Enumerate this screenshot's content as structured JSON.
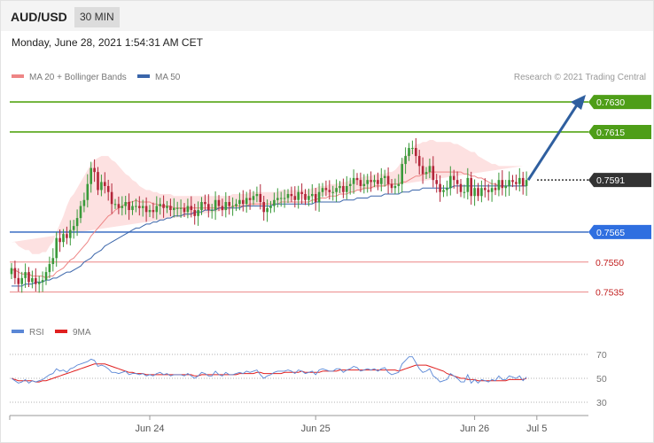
{
  "header": {
    "pair": "AUD/USD",
    "timeframe": "30 MIN"
  },
  "datetime": "Monday, June 28, 2021 1:54:31 AM CET",
  "legend": {
    "ma20_label": "MA 20 + Bollinger Bands",
    "ma50_label": "MA 50"
  },
  "copyright": "Research © 2021 Trading Central",
  "colors": {
    "up": "#3a9a3a",
    "down": "#b3263a",
    "ma20": "#ee8585",
    "ma50": "#3a65aa",
    "band_fill": "#fddcdc",
    "resistance": "#55a515",
    "support": "#4a78c8",
    "target": "#e55555",
    "current": "#333333",
    "arrow": "#2f5f9f",
    "rsi": "#5a87d6",
    "rsi_ma": "#e02020"
  },
  "levels": [
    {
      "price": 0.763,
      "label": "0.7630",
      "kind": "resistance"
    },
    {
      "price": 0.7615,
      "label": "0.7615",
      "kind": "resistance"
    },
    {
      "price": 0.7591,
      "label": "0.7591",
      "kind": "current"
    },
    {
      "price": 0.7565,
      "label": "0.7565",
      "kind": "support"
    },
    {
      "price": 0.755,
      "label": "0.7550",
      "kind": "target"
    },
    {
      "price": 0.7535,
      "label": "0.7535",
      "kind": "target"
    }
  ],
  "x_axis": {
    "ticks": [
      {
        "label": "Jun 24",
        "index": 40
      },
      {
        "label": "Jun 25",
        "index": 88
      },
      {
        "label": "Jun 26",
        "index": 134
      },
      {
        "label": "Jul 5",
        "index": 152
      }
    ]
  },
  "rsi_panel": {
    "label": "RSI",
    "ma_label": "9MA",
    "ticks": [
      70,
      50,
      30
    ],
    "tick_labels": [
      "70",
      "50",
      "30"
    ]
  },
  "chart_data": {
    "type": "candlestick",
    "symbol": "AUD/USD",
    "interval": "30 MIN",
    "ylim": [
      0.7526,
      0.7638
    ],
    "candle_count": 150,
    "closes": [
      0.7547,
      0.7542,
      0.7539,
      0.7542,
      0.7545,
      0.754,
      0.7542,
      0.7539,
      0.754,
      0.7541,
      0.7545,
      0.7549,
      0.7552,
      0.7562,
      0.756,
      0.7564,
      0.7562,
      0.7566,
      0.7568,
      0.7572,
      0.7578,
      0.7581,
      0.7589,
      0.7597,
      0.7595,
      0.7586,
      0.759,
      0.7588,
      0.7585,
      0.7579,
      0.7579,
      0.7577,
      0.7578,
      0.758,
      0.7576,
      0.7578,
      0.7578,
      0.7577,
      0.7578,
      0.7575,
      0.7576,
      0.7575,
      0.7578,
      0.7579,
      0.7577,
      0.7578,
      0.7576,
      0.7577,
      0.7577,
      0.7577,
      0.7575,
      0.7578,
      0.7576,
      0.7573,
      0.7576,
      0.758,
      0.7579,
      0.7576,
      0.7576,
      0.7581,
      0.7578,
      0.7576,
      0.758,
      0.7578,
      0.7578,
      0.7579,
      0.7581,
      0.7579,
      0.7582,
      0.7581,
      0.7583,
      0.7584,
      0.758,
      0.7575,
      0.7577,
      0.7578,
      0.7581,
      0.7582,
      0.7582,
      0.7582,
      0.7584,
      0.7583,
      0.7581,
      0.7585,
      0.7584,
      0.7581,
      0.7583,
      0.7584,
      0.758,
      0.7585,
      0.7587,
      0.7586,
      0.7585,
      0.7585,
      0.7587,
      0.7588,
      0.7585,
      0.7588,
      0.7589,
      0.7592,
      0.7591,
      0.7588,
      0.7589,
      0.7591,
      0.759,
      0.7591,
      0.7589,
      0.7592,
      0.7593,
      0.7589,
      0.7587,
      0.7588,
      0.7589,
      0.7599,
      0.7603,
      0.7607,
      0.7607,
      0.7603,
      0.7598,
      0.7594,
      0.7595,
      0.7598,
      0.7591,
      0.7589,
      0.7585,
      0.7586,
      0.7587,
      0.7593,
      0.7591,
      0.7589,
      0.7585,
      0.7585,
      0.7592,
      0.7583,
      0.7587,
      0.7583,
      0.7587,
      0.7586,
      0.7585,
      0.7587,
      0.7586,
      0.7591,
      0.7587,
      0.7588,
      0.7591,
      0.759,
      0.7589,
      0.7592,
      0.7588,
      0.7591
    ],
    "ma20": [
      0.7546,
      0.7546,
      0.7545,
      0.7544,
      0.7544,
      0.7544,
      0.7543,
      0.7543,
      0.7543,
      0.7543,
      0.7542,
      0.7543,
      0.7543,
      0.7545,
      0.7546,
      0.7547,
      0.7549,
      0.7551,
      0.7552,
      0.7554,
      0.7556,
      0.7558,
      0.756,
      0.7563,
      0.7565,
      0.7567,
      0.7569,
      0.7571,
      0.7573,
      0.7574,
      0.7576,
      0.7577,
      0.7578,
      0.7579,
      0.758,
      0.758,
      0.7581,
      0.758,
      0.758,
      0.758,
      0.758,
      0.7579,
      0.7579,
      0.7578,
      0.7578,
      0.7578,
      0.7578,
      0.7577,
      0.7577,
      0.7577,
      0.7577,
      0.7577,
      0.7577,
      0.7577,
      0.7577,
      0.7577,
      0.7577,
      0.7577,
      0.7577,
      0.7577,
      0.7577,
      0.7577,
      0.7577,
      0.7577,
      0.7578,
      0.7578,
      0.7578,
      0.7578,
      0.7578,
      0.7579,
      0.7579,
      0.7579,
      0.7579,
      0.7579,
      0.7579,
      0.7579,
      0.7579,
      0.7579,
      0.758,
      0.758,
      0.758,
      0.758,
      0.758,
      0.758,
      0.758,
      0.758,
      0.758,
      0.7581,
      0.7581,
      0.7582,
      0.7582,
      0.7582,
      0.7583,
      0.7583,
      0.7583,
      0.7584,
      0.7584,
      0.7584,
      0.7585,
      0.7585,
      0.7586,
      0.7586,
      0.7587,
      0.7587,
      0.7587,
      0.7588,
      0.7588,
      0.7588,
      0.7588,
      0.7589,
      0.7589,
      0.7589,
      0.7589,
      0.759,
      0.759,
      0.7591,
      0.7592,
      0.7593,
      0.7593,
      0.7594,
      0.7594,
      0.7595,
      0.7595,
      0.7595,
      0.7595,
      0.7595,
      0.7595,
      0.7595,
      0.7595,
      0.7595,
      0.7595,
      0.7594,
      0.7594,
      0.7593,
      0.7593,
      0.7592,
      0.7592,
      0.7591,
      0.759,
      0.7589,
      0.7589,
      0.7588,
      0.7588,
      0.7588,
      0.7588,
      0.7588,
      0.7588,
      0.7588,
      0.7588,
      0.7588
    ],
    "ma50": [
      0.7538,
      0.7538,
      0.7538,
      0.7538,
      0.7539,
      0.7539,
      0.7539,
      0.754,
      0.754,
      0.754,
      0.7541,
      0.7541,
      0.7542,
      0.7542,
      0.7543,
      0.7544,
      0.7545,
      0.7545,
      0.7546,
      0.7547,
      0.7548,
      0.755,
      0.7551,
      0.7552,
      0.7554,
      0.7555,
      0.7556,
      0.7558,
      0.7559,
      0.756,
      0.7561,
      0.7562,
      0.7563,
      0.7564,
      0.7565,
      0.7566,
      0.7567,
      0.7567,
      0.7568,
      0.7569,
      0.7569,
      0.757,
      0.757,
      0.7571,
      0.7571,
      0.7572,
      0.7572,
      0.7573,
      0.7573,
      0.7573,
      0.7574,
      0.7574,
      0.7574,
      0.7575,
      0.7575,
      0.7575,
      0.7576,
      0.7576,
      0.7576,
      0.7576,
      0.7577,
      0.7577,
      0.7577,
      0.7577,
      0.7577,
      0.7577,
      0.7577,
      0.7578,
      0.7578,
      0.7578,
      0.7578,
      0.7578,
      0.7578,
      0.7578,
      0.7578,
      0.7578,
      0.7579,
      0.7579,
      0.7579,
      0.7579,
      0.7579,
      0.7579,
      0.7579,
      0.7579,
      0.7579,
      0.7579,
      0.7579,
      0.7579,
      0.758,
      0.758,
      0.758,
      0.758,
      0.758,
      0.758,
      0.758,
      0.758,
      0.7581,
      0.7581,
      0.7581,
      0.7581,
      0.7582,
      0.7582,
      0.7582,
      0.7582,
      0.7583,
      0.7583,
      0.7583,
      0.7583,
      0.7584,
      0.7584,
      0.7584,
      0.7584,
      0.7584,
      0.7585,
      0.7585,
      0.7585,
      0.7586,
      0.7586,
      0.7586,
      0.7587,
      0.7587,
      0.7587,
      0.7587,
      0.7587,
      0.7587,
      0.7587,
      0.7587,
      0.7587,
      0.7588,
      0.7588,
      0.7588,
      0.7588,
      0.7588,
      0.7588,
      0.7588,
      0.7588,
      0.7588,
      0.7588,
      0.7588,
      0.7588,
      0.7588,
      0.7588,
      0.7588,
      0.7588,
      0.7588,
      0.7588,
      0.7588,
      0.7588,
      0.7588,
      0.7588
    ],
    "band_halfwidth": [
      0.0014,
      0.0014,
      0.0013,
      0.0013,
      0.0012,
      0.0012,
      0.0011,
      0.0011,
      0.0011,
      0.0012,
      0.0013,
      0.0015,
      0.0017,
      0.002,
      0.0023,
      0.0026,
      0.0029,
      0.0031,
      0.0032,
      0.0033,
      0.0034,
      0.0035,
      0.0036,
      0.0036,
      0.0036,
      0.0035,
      0.0034,
      0.0032,
      0.003,
      0.0027,
      0.0024,
      0.0021,
      0.0018,
      0.0015,
      0.0013,
      0.0011,
      0.0009,
      0.0008,
      0.0007,
      0.0006,
      0.0006,
      0.0006,
      0.0006,
      0.0006,
      0.0006,
      0.0006,
      0.0006,
      0.0006,
      0.0006,
      0.0006,
      0.0006,
      0.0006,
      0.0006,
      0.0006,
      0.0006,
      0.0006,
      0.0006,
      0.0006,
      0.0006,
      0.0006,
      0.0006,
      0.0006,
      0.0006,
      0.0006,
      0.0006,
      0.0006,
      0.0006,
      0.0006,
      0.0006,
      0.0006,
      0.0006,
      0.0006,
      0.0006,
      0.0006,
      0.0006,
      0.0006,
      0.0006,
      0.0006,
      0.0006,
      0.0006,
      0.0006,
      0.0006,
      0.0006,
      0.0006,
      0.0006,
      0.0006,
      0.0006,
      0.0006,
      0.0006,
      0.0006,
      0.0006,
      0.0006,
      0.0006,
      0.0006,
      0.0006,
      0.0006,
      0.0006,
      0.0006,
      0.0006,
      0.0006,
      0.0006,
      0.0006,
      0.0006,
      0.0006,
      0.0006,
      0.0006,
      0.0006,
      0.0006,
      0.0006,
      0.0006,
      0.0006,
      0.0007,
      0.0009,
      0.0011,
      0.0013,
      0.0014,
      0.0015,
      0.0016,
      0.0016,
      0.0016,
      0.0016,
      0.0016,
      0.0016,
      0.0015,
      0.0015,
      0.0015,
      0.0015,
      0.0015,
      0.0014,
      0.0014,
      0.0013,
      0.0013,
      0.0012,
      0.0012,
      0.0012,
      0.0011,
      0.001,
      0.001,
      0.001,
      0.001,
      0.001,
      0.001,
      0.001,
      0.001,
      0.001,
      0.001,
      0.001,
      0.001,
      0.001
    ],
    "rsi": [
      50,
      48,
      46,
      47,
      49,
      46,
      48,
      47,
      48,
      49,
      51,
      53,
      54,
      58,
      56,
      57,
      55,
      58,
      59,
      61,
      62,
      63,
      64,
      66,
      65,
      60,
      61,
      60,
      58,
      55,
      55,
      54,
      55,
      56,
      53,
      54,
      54,
      53,
      54,
      52,
      53,
      52,
      54,
      55,
      53,
      54,
      52,
      53,
      53,
      53,
      52,
      54,
      52,
      50,
      52,
      55,
      54,
      52,
      52,
      56,
      53,
      52,
      55,
      53,
      53,
      54,
      55,
      54,
      56,
      55,
      56,
      57,
      53,
      50,
      52,
      53,
      55,
      56,
      56,
      56,
      57,
      56,
      54,
      57,
      56,
      54,
      55,
      56,
      53,
      57,
      58,
      57,
      56,
      56,
      58,
      58,
      55,
      57,
      58,
      60,
      59,
      56,
      57,
      58,
      57,
      58,
      56,
      58,
      59,
      55,
      53,
      54,
      55,
      62,
      65,
      68,
      68,
      63,
      58,
      55,
      56,
      58,
      52,
      50,
      47,
      48,
      49,
      54,
      52,
      50,
      47,
      47,
      53,
      46,
      49,
      46,
      49,
      48,
      47,
      49,
      48,
      52,
      49,
      49,
      52,
      51,
      50,
      52,
      48,
      51
    ],
    "rsi_ma": [
      50,
      49,
      48,
      48,
      48,
      48,
      48,
      47,
      47,
      48,
      48,
      49,
      50,
      51,
      52,
      53,
      54,
      55,
      56,
      57,
      58,
      59,
      60,
      61,
      62,
      62,
      62,
      62,
      61,
      60,
      59,
      58,
      57,
      56,
      55,
      55,
      54,
      54,
      54,
      53,
      53,
      53,
      53,
      53,
      53,
      53,
      53,
      53,
      53,
      53,
      53,
      53,
      53,
      52,
      52,
      53,
      53,
      53,
      53,
      53,
      53,
      53,
      53,
      53,
      53,
      53,
      54,
      54,
      54,
      54,
      54,
      55,
      55,
      54,
      54,
      54,
      54,
      54,
      54,
      55,
      55,
      55,
      55,
      55,
      56,
      55,
      55,
      55,
      55,
      55,
      56,
      56,
      56,
      56,
      56,
      57,
      57,
      57,
      57,
      57,
      57,
      57,
      57,
      57,
      57,
      57,
      57,
      57,
      57,
      57,
      57,
      57,
      56,
      57,
      58,
      59,
      60,
      61,
      61,
      61,
      61,
      60,
      59,
      58,
      57,
      56,
      54,
      53,
      52,
      51,
      50,
      50,
      49,
      49,
      49,
      48,
      48,
      48,
      48,
      48,
      48,
      48,
      48,
      48,
      49,
      49,
      49,
      49,
      49,
      50
    ]
  }
}
